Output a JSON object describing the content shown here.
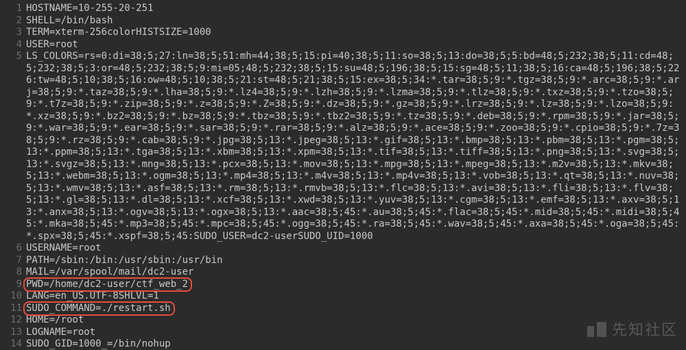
{
  "lines": [
    {
      "n": "1",
      "text": "HOSTNAME=10-255-20-251",
      "hl": false
    },
    {
      "n": "2",
      "text": "SHELL=/bin/bash",
      "hl": false
    },
    {
      "n": "3",
      "text": "TERM=xterm-256colorHISTSIZE=1000",
      "hl": false
    },
    {
      "n": "4",
      "text": "USER=root",
      "hl": false
    },
    {
      "n": "5",
      "text": "LS_COLORS=rs=0:di=38;5;27:ln=38;5;51:mh=44;38;5;15:pi=40;38;5;11:so=38;5;13:do=38;5;5:bd=48;5;232;38;5;11:cd=48;5;232;38;5;3:or=48;5;232;38;5;9:mi=05;48;5;232;38;5;15:su=48;5;196;38;5;15:sg=48;5;11;38;5;16:ca=48;5;196;38;5;226:tw=48;5;10;38;5;16:ow=48;5;10;38;5;21:st=48;5;21;38;5;15:ex=38;5;34:*.tar=38;5;9:*.tgz=38;5;9:*.arc=38;5;9:*.arj=38;5;9:*.taz=38;5;9:*.lha=38;5;9:*.lz4=38;5;9:*.lzh=38;5;9:*.lzma=38;5;9:*.tlz=38;5;9:*.txz=38;5;9:*.tzo=38;5;9:*.t7z=38;5;9:*.zip=38;5;9:*.z=38;5;9:*.Z=38;5;9:*.dz=38;5;9:*.gz=38;5;9:*.lrz=38;5;9:*.lz=38;5;9:*.lzo=38;5;9:*.xz=38;5;9:*.bz2=38;5;9:*.bz=38;5;9:*.tbz=38;5;9:*.tbz2=38;5;9:*.tz=38;5;9:*.deb=38;5;9:*.rpm=38;5;9:*.jar=38;5;9:*.war=38;5;9:*.ear=38;5;9:*.sar=38;5;9:*.rar=38;5;9:*.alz=38;5;9:*.ace=38;5;9:*.zoo=38;5;9:*.cpio=38;5;9:*.7z=38;5;9:*.rz=38;5;9:*.cab=38;5;9:*.jpg=38;5;13:*.jpeg=38;5;13:*.gif=38;5;13:*.bmp=38;5;13:*.pbm=38;5;13:*.pgm=38;5;13:*.ppm=38;5;13:*.tga=38;5;13:*.xbm=38;5;13:*.xpm=38;5;13:*.tif=38;5;13:*.tiff=38;5;13:*.png=38;5;13:*.svg=38;5;13:*.svgz=38;5;13:*.mng=38;5;13:*.pcx=38;5;13:*.mov=38;5;13:*.mpg=38;5;13:*.mpeg=38;5;13:*.m2v=38;5;13:*.mkv=38;5;13:*.webm=38;5;13:*.ogm=38;5;13:*.mp4=38;5;13:*.m4v=38;5;13:*.mp4v=38;5;13:*.vob=38;5;13:*.qt=38;5;13:*.nuv=38;5;13:*.wmv=38;5;13:*.asf=38;5;13:*.rm=38;5;13:*.rmvb=38;5;13:*.flc=38;5;13:*.avi=38;5;13:*.fli=38;5;13:*.flv=38;5;13:*.gl=38;5;13:*.dl=38;5;13:*.xcf=38;5;13:*.xwd=38;5;13:*.yuv=38;5;13:*.cgm=38;5;13:*.emf=38;5;13:*.axv=38;5;13:*.anx=38;5;13:*.ogv=38;5;13:*.ogx=38;5;13:*.aac=38;5;45:*.au=38;5;45:*.flac=38;5;45:*.mid=38;5;45:*.midi=38;5;45:*.mka=38;5;45:*.mp3=38;5;45:*.mpc=38;5;45:*.ogg=38;5;45:*.ra=38;5;45:*.wav=38;5;45:*.axa=38;5;45:*.oga=38;5;45:*.spx=38;5;45:*.xspf=38;5;45:SUDO_USER=dc2-userSUDO_UID=1000",
      "hl": false
    },
    {
      "n": "6",
      "text": "USERNAME=root",
      "hl": false
    },
    {
      "n": "7",
      "text": "PATH=/sbin:/bin:/usr/sbin:/usr/bin",
      "hl": false
    },
    {
      "n": "8",
      "text": "MAIL=/var/spool/mail/dc2-user",
      "hl": false
    },
    {
      "n": "9",
      "text": "PWD=/home/dc2-user/ctf_web_2",
      "hl": true
    },
    {
      "n": "10",
      "text": "LANG=en_US.UTF-8SHLVL=1",
      "hl": false
    },
    {
      "n": "11",
      "text": "SUDO_COMMAND=./restart.sh",
      "hl": true
    },
    {
      "n": "12",
      "text": "HOME=/root",
      "hl": false
    },
    {
      "n": "13",
      "text": "LOGNAME=root",
      "hl": false
    },
    {
      "n": "14",
      "text": "SUDO_GID=1000_=/bin/nohup",
      "hl": false
    }
  ],
  "watermark": "先知社区"
}
